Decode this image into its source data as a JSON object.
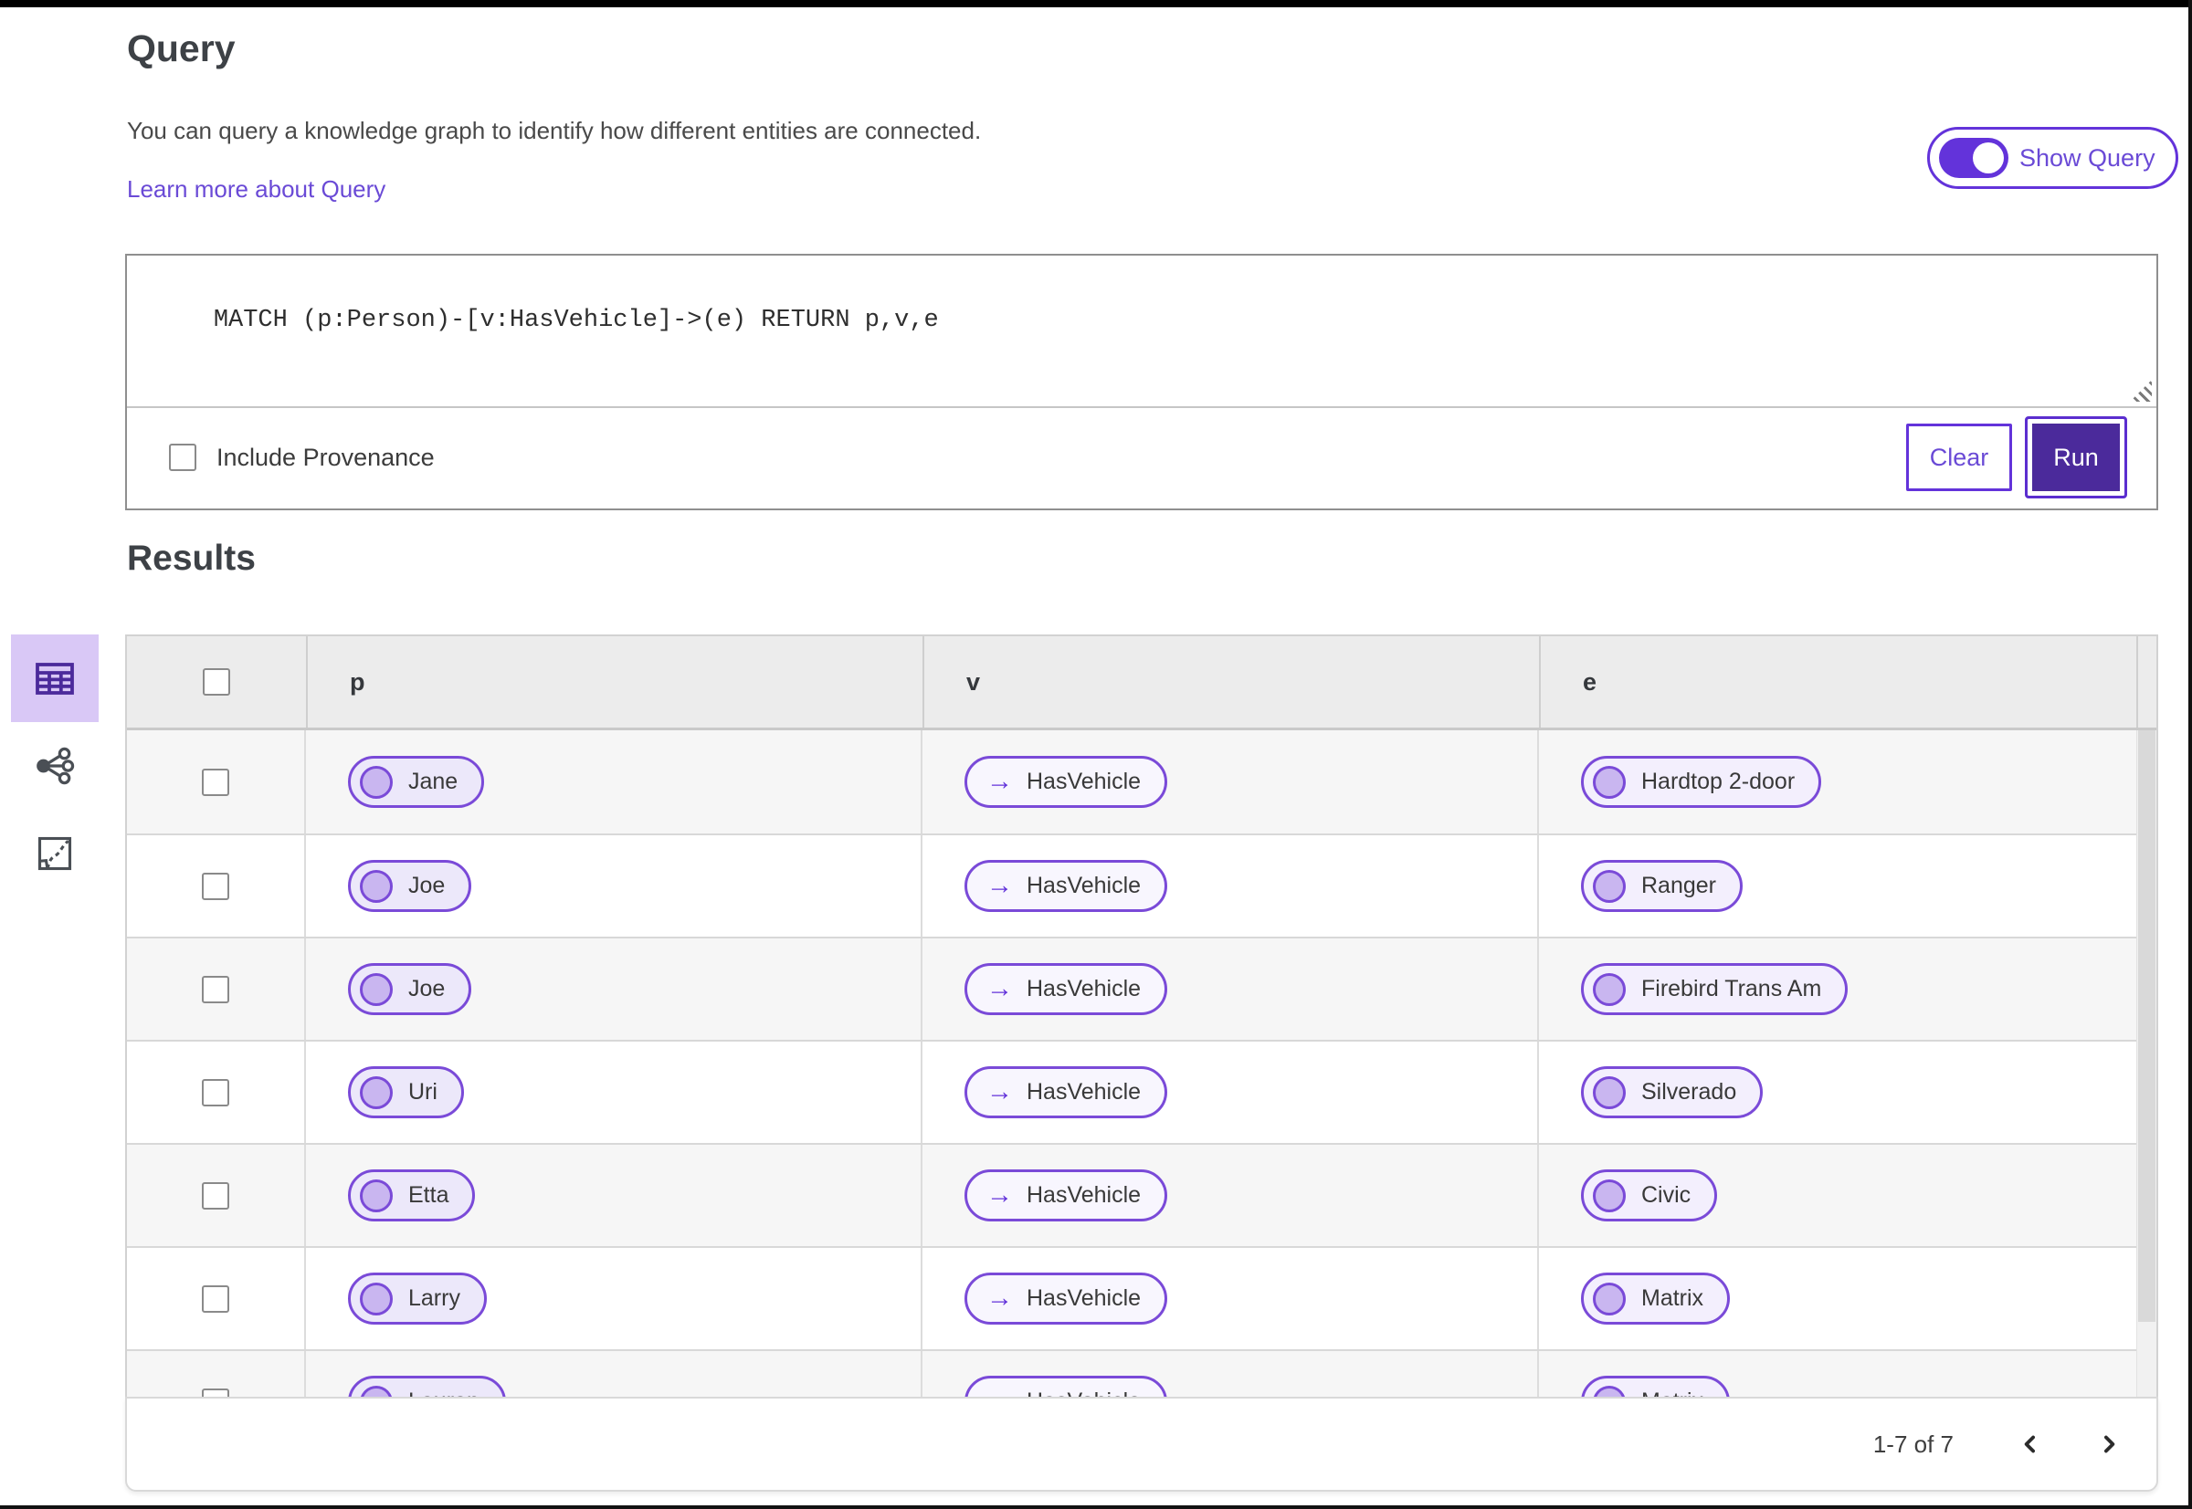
{
  "page": {
    "title": "Query",
    "description": "You can query a knowledge graph to identify how different entities are connected.",
    "learn_more_link": "Learn more about Query",
    "show_query_toggle": {
      "label": "Show Query",
      "state": "on"
    }
  },
  "query_editor": {
    "query_text": "MATCH (p:Person)-[v:HasVehicle]->(e) RETURN p,v,e",
    "include_provenance": {
      "label": "Include Provenance",
      "checked": false
    },
    "clear_button": "Clear",
    "run_button": "Run"
  },
  "results": {
    "title": "Results",
    "view_switcher": [
      {
        "name": "table-view",
        "icon": "table-icon",
        "selected": true
      },
      {
        "name": "graph-view",
        "icon": "graph-icon",
        "selected": false
      },
      {
        "name": "map-view",
        "icon": "map-icon",
        "selected": false
      }
    ],
    "table": {
      "columns": [
        "p",
        "v",
        "e"
      ],
      "rows": [
        {
          "p": "Jane",
          "v": "HasVehicle",
          "e": "Hardtop 2-door"
        },
        {
          "p": "Joe",
          "v": "HasVehicle",
          "e": "Ranger"
        },
        {
          "p": "Joe",
          "v": "HasVehicle",
          "e": "Firebird Trans Am"
        },
        {
          "p": "Uri",
          "v": "HasVehicle",
          "e": "Silverado"
        },
        {
          "p": "Etta",
          "v": "HasVehicle",
          "e": "Civic"
        },
        {
          "p": "Larry",
          "v": "HasVehicle",
          "e": "Matrix"
        },
        {
          "p": "Lauren",
          "v": "HasVehicle",
          "e": "Matrix"
        }
      ]
    },
    "pagination": {
      "range_label": "1-7 of 7",
      "prev_icon": "chevron-left-icon",
      "next_icon": "chevron-right-icon"
    }
  },
  "colors": {
    "accent_purple": "#6333da",
    "deep_purple": "#4b2a9b",
    "pill_border": "#7a4ad8",
    "link_purple": "#6a4ad6",
    "selected_view_bg": "#d9c8f6",
    "header_bg": "#ececec",
    "row_alt_bg": "#f6f6f6"
  }
}
